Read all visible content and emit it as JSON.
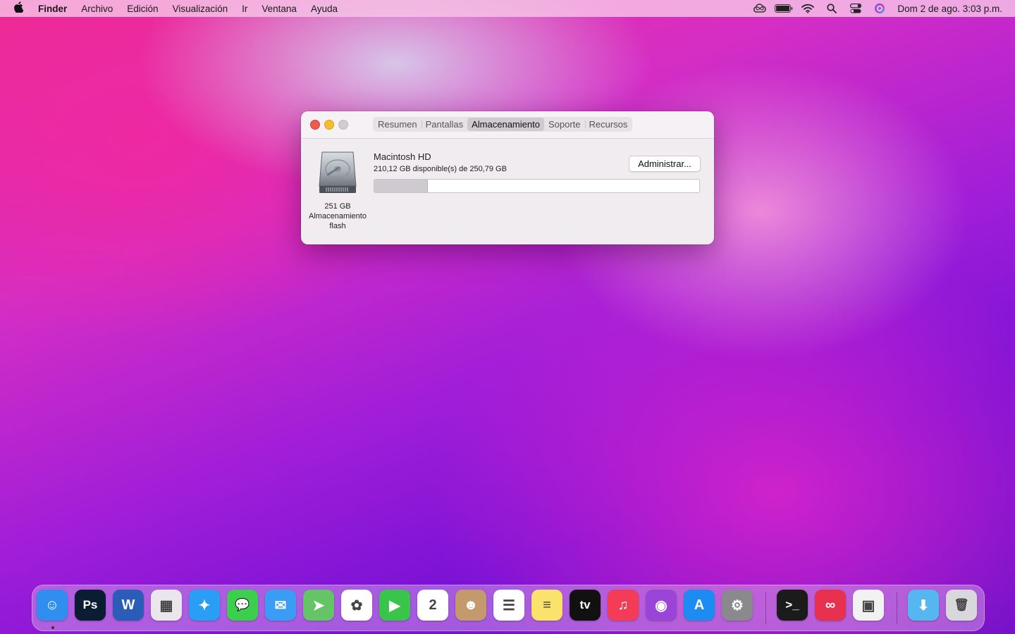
{
  "menubar": {
    "apple_icon": "apple-logo-icon",
    "app_name": "Finder",
    "menus": [
      "Archivo",
      "Edición",
      "Visualización",
      "Ir",
      "Ventana",
      "Ayuda"
    ],
    "status_icons": [
      "creative-cloud-icon",
      "battery-icon",
      "wifi-icon",
      "spotlight-search-icon",
      "control-center-icon",
      "siri-icon"
    ],
    "clock": "Dom 2 de ago.  3:03 p.m."
  },
  "window": {
    "tabs": [
      {
        "label": "Resumen",
        "active": false
      },
      {
        "label": "Pantallas",
        "active": false
      },
      {
        "label": "Almacenamiento",
        "active": true
      },
      {
        "label": "Soporte",
        "active": false
      },
      {
        "label": "Recursos",
        "active": false
      }
    ],
    "disk": {
      "caption_line1": "251 GB",
      "caption_line2": "Almacenamiento",
      "caption_line3": "flash",
      "name": "Macintosh HD",
      "free_text": "210,12 GB disponible(s) de 250,79 GB",
      "used_fraction": 0.162
    },
    "manage_button": "Administrar..."
  },
  "dock": {
    "apps": [
      {
        "name": "Finder",
        "icon": "finder-icon",
        "color": "#2f8ef0",
        "glyph": "☺",
        "running": true
      },
      {
        "name": "Photoshop",
        "icon": "photoshop-icon",
        "color": "#0b1d33",
        "glyph": "Ps",
        "running": false
      },
      {
        "name": "Word",
        "icon": "word-icon",
        "color": "#2b5cb8",
        "glyph": "W",
        "running": false
      },
      {
        "name": "Launchpad",
        "icon": "launchpad-icon",
        "color": "#e9e6ee",
        "glyph": "▦",
        "running": false
      },
      {
        "name": "Safari",
        "icon": "safari-icon",
        "color": "#2a9df4",
        "glyph": "✦",
        "running": false
      },
      {
        "name": "Mensajes",
        "icon": "messages-icon",
        "color": "#3ccf4e",
        "glyph": "💬",
        "running": false
      },
      {
        "name": "Mail",
        "icon": "mail-icon",
        "color": "#3b9cf5",
        "glyph": "✉",
        "running": false
      },
      {
        "name": "Mapas",
        "icon": "maps-icon",
        "color": "#65c466",
        "glyph": "➤",
        "running": false
      },
      {
        "name": "Fotos",
        "icon": "photos-icon",
        "color": "#ffffff",
        "glyph": "✿",
        "running": false
      },
      {
        "name": "FaceTime",
        "icon": "facetime-icon",
        "color": "#39c44b",
        "glyph": "▶",
        "running": false
      },
      {
        "name": "Calendario",
        "icon": "calendar-icon",
        "color": "#ffffff",
        "glyph": "2",
        "running": false
      },
      {
        "name": "Contactos",
        "icon": "contacts-icon",
        "color": "#c49a6c",
        "glyph": "☻",
        "running": false
      },
      {
        "name": "Recordatorios",
        "icon": "reminders-icon",
        "color": "#ffffff",
        "glyph": "☰",
        "running": false
      },
      {
        "name": "Notas",
        "icon": "notes-icon",
        "color": "#fbe36b",
        "glyph": "≡",
        "running": false
      },
      {
        "name": "TV",
        "icon": "apple-tv-icon",
        "color": "#111111",
        "glyph": "tv",
        "running": false
      },
      {
        "name": "Música",
        "icon": "music-icon",
        "color": "#f53c56",
        "glyph": "♫",
        "running": false
      },
      {
        "name": "Podcasts",
        "icon": "podcasts-icon",
        "color": "#9a45d8",
        "glyph": "◉",
        "running": false
      },
      {
        "name": "App Store",
        "icon": "app-store-icon",
        "color": "#1c8cf3",
        "glyph": "A",
        "running": false
      },
      {
        "name": "Preferencias",
        "icon": "system-preferences-icon",
        "color": "#8a8a8e",
        "glyph": "⚙",
        "running": false
      },
      {
        "name": "Terminal",
        "icon": "terminal-icon",
        "color": "#1b1b1b",
        "glyph": ">_",
        "running": false
      },
      {
        "name": "Creative Cloud",
        "icon": "creative-cloud-app-icon",
        "color": "#e8304f",
        "glyph": "∞",
        "running": false
      },
      {
        "name": "Sistema",
        "icon": "system-info-icon",
        "color": "#f2f2f2",
        "glyph": "▣",
        "running": false
      },
      {
        "name": "Descargas",
        "icon": "downloads-folder-icon",
        "color": "#56b6f0",
        "glyph": "⬇",
        "running": false
      },
      {
        "name": "Papelera",
        "icon": "trash-icon",
        "color": "#d8d8dc",
        "glyph": "🗑",
        "running": false
      }
    ]
  }
}
